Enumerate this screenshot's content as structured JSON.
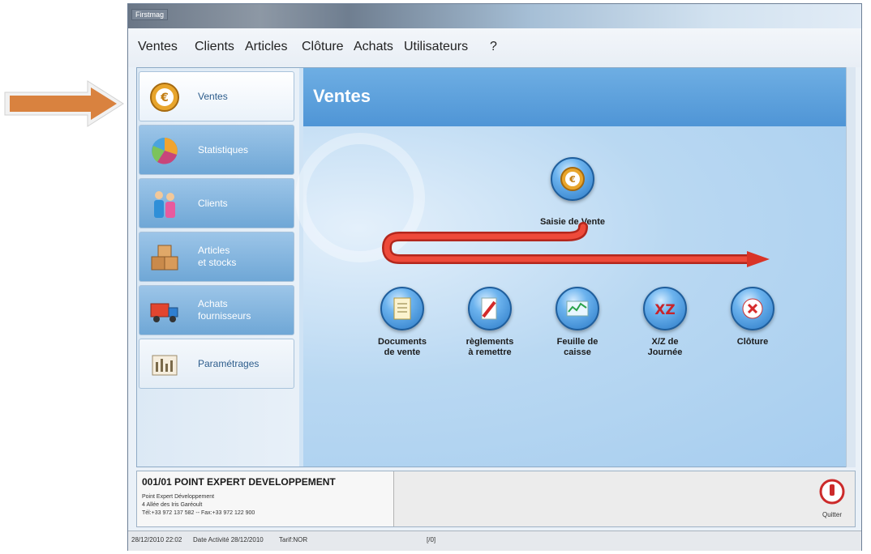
{
  "window": {
    "title": "Firstmag"
  },
  "menu": [
    "Ventes",
    "Clients",
    "Articles",
    "Clôture",
    "Achats",
    "Utilisateurs",
    "?"
  ],
  "sidebar": {
    "items": [
      {
        "label": "Ventes",
        "icon": "euro-coin-icon",
        "state": "active"
      },
      {
        "label": "Statistiques",
        "icon": "pie-chart-icon"
      },
      {
        "label": "Clients",
        "icon": "people-icon"
      },
      {
        "label": "Articles\net stocks",
        "icon": "boxes-icon"
      },
      {
        "label": "Achats\nfournisseurs",
        "icon": "truck-icon"
      },
      {
        "label": "Paramétrages",
        "icon": "settings-icon",
        "state": "plain"
      }
    ]
  },
  "main": {
    "title": "Ventes",
    "saisie_label": "Saisie de Vente",
    "buttons": [
      {
        "label": "Documents\nde vente",
        "icon": "document-icon"
      },
      {
        "label": "règlements\nà remettre",
        "icon": "pen-icon"
      },
      {
        "label": "Feuille de\ncaisse",
        "icon": "chart-sheet-icon"
      },
      {
        "label": "X/Z de\nJournée",
        "icon": "xz-icon"
      },
      {
        "label": "Clôture",
        "icon": "close-x-icon"
      }
    ]
  },
  "footer": {
    "company_name": "001/01 POINT EXPERT DEVELOPPEMENT",
    "company_lines": [
      "Point Expert Développement",
      "4 Allée des Iris Garéoult",
      "Tél:+33 972 137 582 -- Fax:+33 972 122 900"
    ],
    "quit_label": "Quitter"
  },
  "status": {
    "datetime": "28/12/2010 22:02",
    "activity": "Date Activité 28/12/2010",
    "tarif": "Tarif:NOR",
    "extra": "[/0]"
  },
  "colors": {
    "accent": "#4f95d6",
    "flow_arrow": "#e23a2e",
    "highlight_arrow": "#d9823f"
  }
}
